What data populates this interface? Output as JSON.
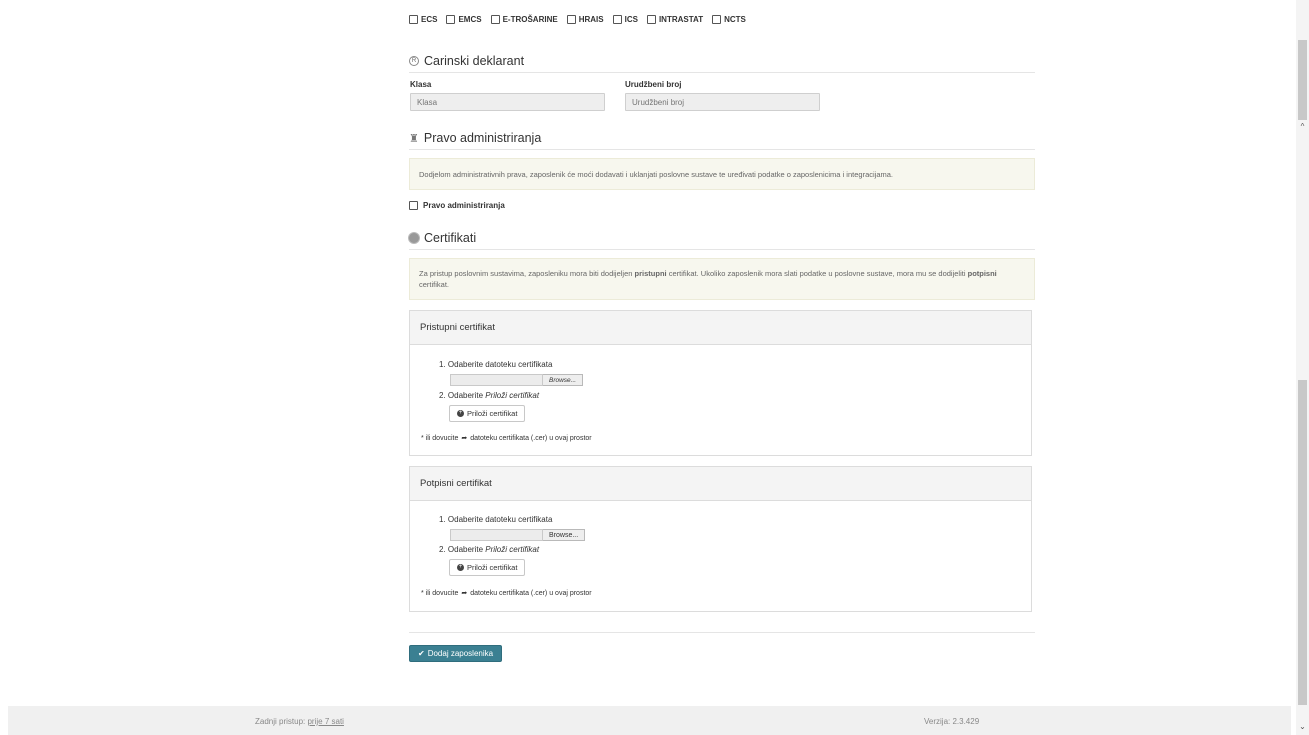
{
  "systems": [
    "ECS",
    "EMCS",
    "E-TROŠARINE",
    "HRAIS",
    "ICS",
    "INTRASTAT",
    "NCTS"
  ],
  "customs": {
    "title": "Carinski deklarant",
    "klasa_label": "Klasa",
    "klasa_placeholder": "Klasa",
    "urudzbeni_label": "Urudžbeni broj",
    "urudzbeni_placeholder": "Urudžbeni broj"
  },
  "admin": {
    "title": "Pravo administriranja",
    "notice": "Dodjelom administrativnih prava, zaposlenik će moći dodavati i uklanjati poslovne sustave te uređivati podatke o zaposlenicima i integracijama.",
    "checkbox_label": "Pravo administriranja"
  },
  "certificates": {
    "title": "Certifikati",
    "notice_part1": "Za pristup poslovnim sustavima, zaposleniku mora biti dodijeljen ",
    "notice_bold1": "pristupni",
    "notice_part2": " certifikat. Ukoliko zaposlenik mora slati podatke u poslovne sustave, mora mu se dodijeliti ",
    "notice_bold2": "potpisni",
    "notice_part3": " certifikat.",
    "access_panel": {
      "title": "Pristupni certifikat",
      "step1": "1.  Odaberite datoteku certifikata",
      "browse": "Browse...",
      "step2_prefix": "2.  Odaberite ",
      "step2_italic": "Priloži certifikat",
      "attach": "Priloži certifikat",
      "drop_prefix": "* ili dovucite",
      "drop_suffix": "datoteku certifikata (.cer) u ovaj prostor"
    },
    "sign_panel": {
      "title": "Potpisni certifikat",
      "step1": "1.  Odaberite datoteku certifikata",
      "browse": "Browse...",
      "step2_prefix": "2.  Odaberite ",
      "step2_italic": "Priloži certifikat",
      "attach": "Priloži certifikat",
      "drop_prefix": "* ili dovucite",
      "drop_suffix": "datoteku certifikata (.cer) u ovaj prostor"
    }
  },
  "submit_label": "Dodaj zaposlenika",
  "footer": {
    "last_access_label": "Zadnji pristup:",
    "last_access_value": "prije 7 sati",
    "version": "Verzija: 2.3.429"
  }
}
